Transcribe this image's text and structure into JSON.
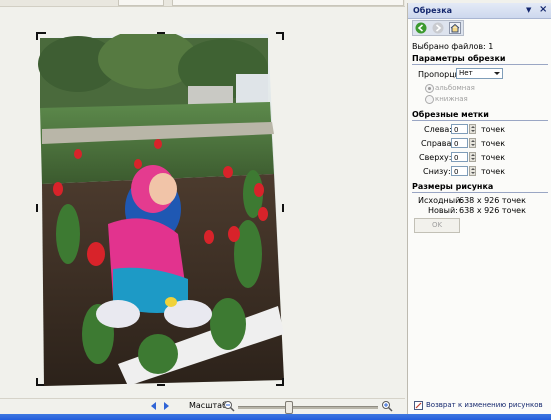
{
  "pane": {
    "title": "Обрезка",
    "files_selected": "Выбрано файлов: 1",
    "crop_params_header": "Параметры обрезки",
    "proportions_label": "Пропорции:",
    "proportions_value": "Нет",
    "orientation_landscape": "альбомная",
    "orientation_portrait": "книжная",
    "crop_marks_header": "Обрезные метки",
    "marks": [
      {
        "label": "Слева:",
        "value": "0",
        "unit": "точек"
      },
      {
        "label": "Справа:",
        "value": "0",
        "unit": "точек"
      },
      {
        "label": "Сверху:",
        "value": "0",
        "unit": "точек"
      },
      {
        "label": "Снизу:",
        "value": "0",
        "unit": "точек"
      }
    ],
    "size_header": "Размеры рисунка",
    "original_label": "Исходный:",
    "original_value": "638 x 926 точек",
    "new_label": "Новый:",
    "new_value": "638 x 926 точек",
    "ok_label": "OK",
    "footer_link": "Возврат к изменению рисунков"
  },
  "bottombar": {
    "zoom_label": "Масштаб:",
    "zoom_level": 0.36
  },
  "icons": {
    "back": "back-arrow-icon",
    "forward": "forward-arrow-icon",
    "home": "home-icon",
    "zoom_out": "zoom-out-icon",
    "zoom_in": "zoom-in-icon",
    "prev": "previous-picture-icon",
    "next": "next-picture-icon"
  },
  "colors": {
    "accent": "#15286e",
    "nav_arrow": "#2f64d6"
  }
}
